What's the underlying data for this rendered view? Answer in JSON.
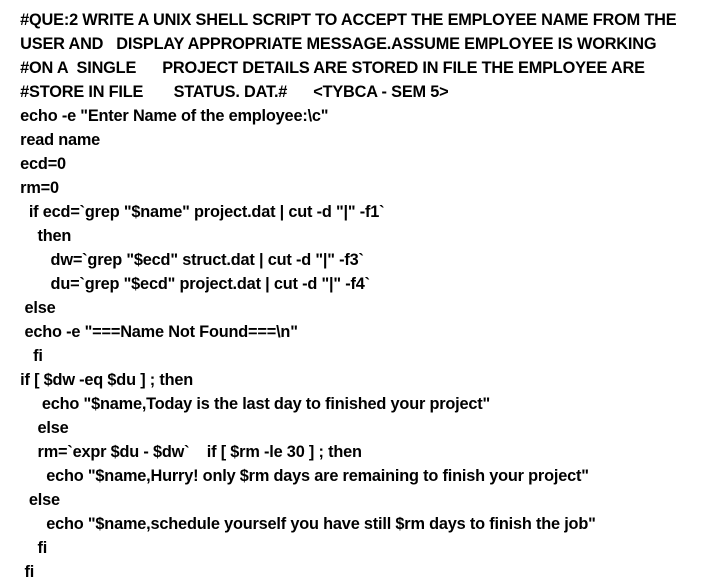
{
  "document": {
    "type": "code-listing",
    "language": "bash",
    "background_color": "#ffffff",
    "text_color": "#000000",
    "lines": [
      "#QUE:2 WRITE A UNIX SHELL SCRIPT TO ACCEPT THE EMPLOYEE NAME FROM THE",
      "USER AND   DISPLAY APPROPRIATE MESSAGE.ASSUME EMPLOYEE IS WORKING",
      "#ON A  SINGLE      PROJECT DETAILS ARE STORED IN FILE THE EMPLOYEE ARE",
      "#STORE IN FILE       STATUS. DAT.#      <TYBCA - SEM 5>",
      "echo -e \"Enter Name of the employee:\\c\"",
      "read name",
      "ecd=0",
      "rm=0",
      "  if ecd=`grep \"$name\" project.dat | cut -d \"|\" -f1`",
      "    then",
      "       dw=`grep \"$ecd\" struct.dat | cut -d \"|\" -f3`",
      "       du=`grep \"$ecd\" project.dat | cut -d \"|\" -f4`",
      " else",
      " echo -e \"===Name Not Found===\\n\"",
      "   fi",
      "if [ $dw -eq $du ] ; then",
      "     echo \"$name,Today is the last day to finished your project\"",
      "    else",
      "    rm=`expr $du - $dw`    if [ $rm -le 30 ] ; then",
      "      echo \"$name,Hurry! only $rm days are remaining to finish your project\"",
      "  else",
      "      echo \"$name,schedule yourself you have still $rm days to finish the job\"",
      "    fi",
      " fi"
    ]
  }
}
